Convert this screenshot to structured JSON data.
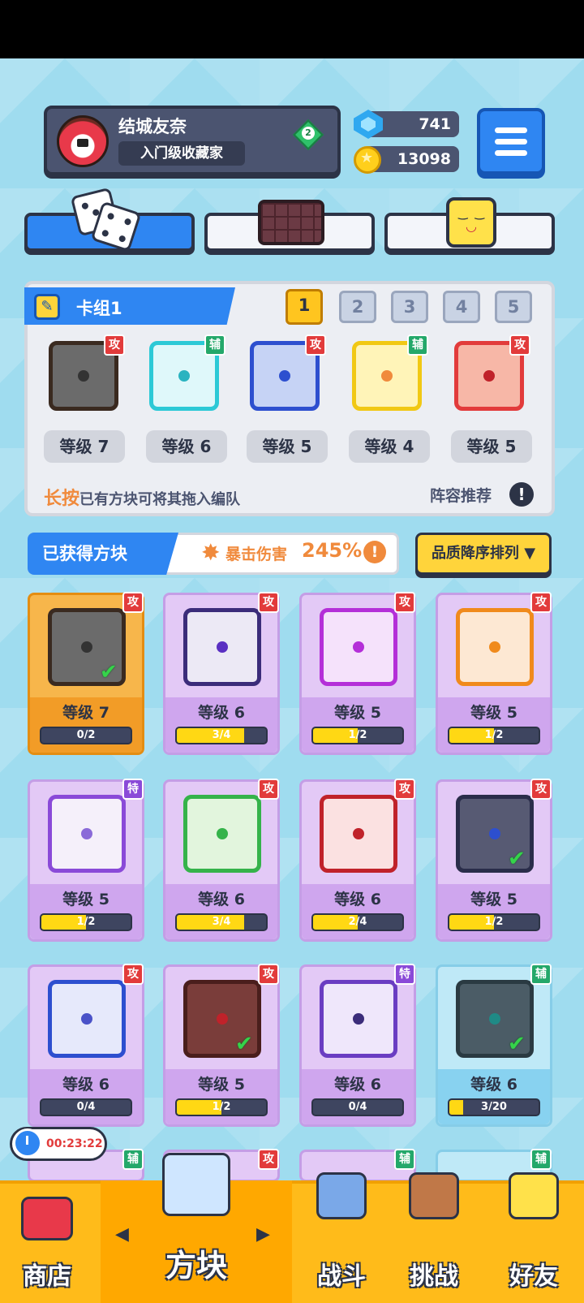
{
  "profile": {
    "name": "结城友奈",
    "title": "入门级收藏家",
    "rank": "2"
  },
  "currency": {
    "gems": "741",
    "coins": "13098"
  },
  "tabs": [
    {
      "id": "dice",
      "active": true
    },
    {
      "id": "chocolate",
      "active": false
    },
    {
      "id": "smiley",
      "active": false
    }
  ],
  "deck": {
    "title": "卡组1",
    "deck_tabs": [
      "1",
      "2",
      "3",
      "4",
      "5"
    ],
    "active_tab": "1",
    "cards": [
      {
        "type": "攻",
        "level": "等级 7",
        "color": "#6b6b6b",
        "border": "#3a2a20",
        "dot": "#333333"
      },
      {
        "type": "辅",
        "level": "等级 6",
        "color": "#dff8fa",
        "border": "#2cc9d6",
        "dot": "#2ab3c0"
      },
      {
        "type": "攻",
        "level": "等级 5",
        "color": "#c6d3f5",
        "border": "#2d4fcf",
        "dot": "#2d4fcf"
      },
      {
        "type": "辅",
        "level": "等级 4",
        "color": "#fff4b8",
        "border": "#f1c814",
        "dot": "#f08a3c"
      },
      {
        "type": "攻",
        "level": "等级 5",
        "color": "#f7b7a7",
        "border": "#e23b3b",
        "dot": "#c0222a"
      }
    ],
    "hint_highlight": "长按",
    "hint_rest": "已有方块可将其拖入编队",
    "recommend": "阵容推荐",
    "info": "!"
  },
  "obtained": {
    "label": "已获得方块",
    "crit_label": "暴击伤害",
    "crit_value": "245%",
    "info": "!",
    "sort": "品质降序排列 ▼"
  },
  "grid": [
    {
      "type": "攻",
      "level": "等级 7",
      "progress": "0/2",
      "fill": 0,
      "style": "gold",
      "color": "#6b6b6b",
      "border": "#3a2a20",
      "dot": "#333333",
      "check": true
    },
    {
      "type": "攻",
      "level": "等级 6",
      "progress": "3/4",
      "fill": 0.75,
      "style": "purple",
      "color": "#ece9f5",
      "border": "#3b2c7a",
      "dot": "#5a2fc2",
      "check": false
    },
    {
      "type": "攻",
      "level": "等级 5",
      "progress": "1/2",
      "fill": 0.5,
      "style": "purple",
      "color": "#f5e2fb",
      "border": "#b42fd8",
      "dot": "#b42fd8",
      "check": false
    },
    {
      "type": "攻",
      "level": "等级 5",
      "progress": "1/2",
      "fill": 0.5,
      "style": "purple",
      "color": "#fde8d3",
      "border": "#f08a1c",
      "dot": "#f08a1c",
      "check": false
    },
    {
      "type": "特",
      "level": "等级 5",
      "progress": "1/2",
      "fill": 0.5,
      "style": "purple",
      "color": "#f5f0fa",
      "border": "#8a4ad8",
      "dot": "#8a6ad8",
      "check": false
    },
    {
      "type": "攻",
      "level": "等级 6",
      "progress": "3/4",
      "fill": 0.75,
      "style": "purple",
      "color": "#e2f5dd",
      "border": "#35b34a",
      "dot": "#35b34a",
      "check": false
    },
    {
      "type": "攻",
      "level": "等级 6",
      "progress": "2/4",
      "fill": 0.5,
      "style": "purple",
      "color": "#fbe1e1",
      "border": "#c0222a",
      "dot": "#c0222a",
      "check": false
    },
    {
      "type": "攻",
      "level": "等级 5",
      "progress": "1/2",
      "fill": 0.5,
      "style": "purple",
      "color": "#575a73",
      "border": "#2a2d4a",
      "dot": "#2d4fcf",
      "check": true
    },
    {
      "type": "攻",
      "level": "等级 6",
      "progress": "0/4",
      "fill": 0,
      "style": "purple",
      "color": "#e6e9fb",
      "border": "#2d4fcf",
      "dot": "#4a52c8",
      "check": false
    },
    {
      "type": "攻",
      "level": "等级 5",
      "progress": "1/2",
      "fill": 0.5,
      "style": "purple",
      "color": "#7a3d3a",
      "border": "#4a1e1c",
      "dot": "#c0222a",
      "check": true
    },
    {
      "type": "特",
      "level": "等级 6",
      "progress": "0/4",
      "fill": 0,
      "style": "purple",
      "color": "#efe7fb",
      "border": "#6a3dc2",
      "dot": "#3b2c7a",
      "check": false
    },
    {
      "type": "辅",
      "level": "等级 6",
      "progress": "3/20",
      "fill": 0.15,
      "style": "blue",
      "color": "#4b5c66",
      "border": "#2a3a42",
      "dot": "#1f8a86",
      "check": true
    }
  ],
  "partial_row_badges": [
    "辅",
    "攻",
    "辅",
    "辅"
  ],
  "timer": "00:23:22",
  "nav": [
    {
      "label": "商店",
      "active": false
    },
    {
      "label": "方块",
      "active": true
    },
    {
      "label": "战斗",
      "active": false
    },
    {
      "label": "挑战",
      "active": false
    },
    {
      "label": "好友",
      "active": false
    }
  ]
}
